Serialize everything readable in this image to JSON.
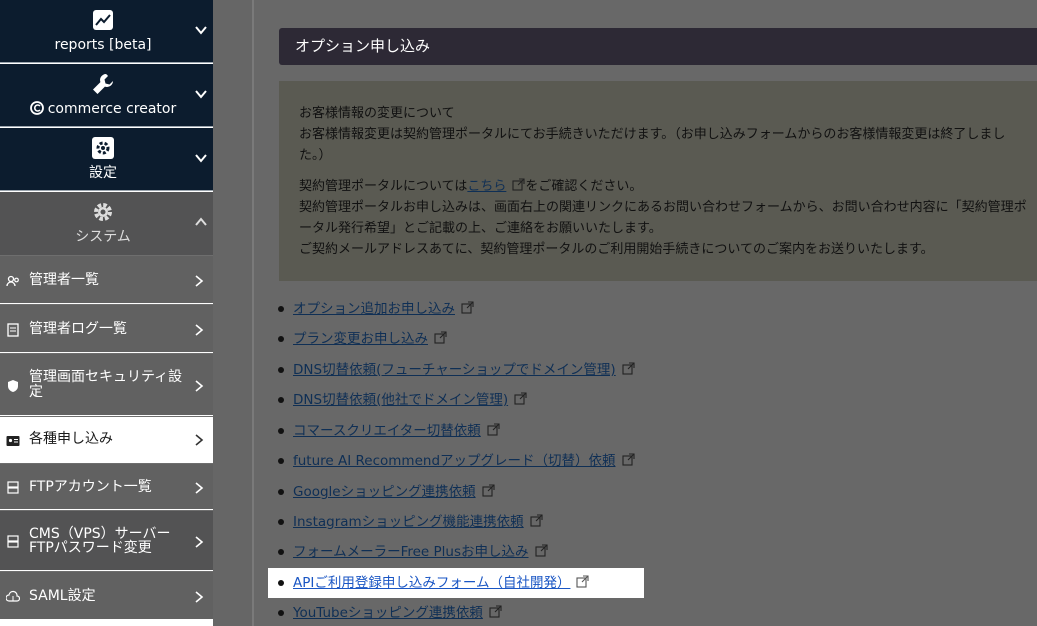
{
  "sidebar": {
    "major": [
      {
        "label": "reports [beta]",
        "icon": "chart-icon"
      },
      {
        "label": "commerce creator",
        "icon": "wrench-icon"
      },
      {
        "label": "設定",
        "icon": "gear-box-icon"
      },
      {
        "label": "システム",
        "icon": "gear-icon"
      }
    ],
    "items": [
      {
        "label": "管理者一覧",
        "icon": "users-icon"
      },
      {
        "label": "管理者ログ一覧",
        "icon": "log-icon"
      },
      {
        "label": "管理画面セキュリティ設定",
        "icon": "shield-icon"
      },
      {
        "label": "各種申し込み",
        "icon": "id-card-icon"
      },
      {
        "label": "FTPアカウント一覧",
        "icon": "server-icon"
      },
      {
        "label": "CMS（VPS）サーバーFTPパスワード変更",
        "icon": "server-icon"
      },
      {
        "label": "SAML設定",
        "icon": "cloud-icon"
      }
    ]
  },
  "main": {
    "section_title": "オプション申し込み",
    "notice": {
      "p1_line1": "お客様情報の変更について",
      "p1_line2": "お客様情報変更は契約管理ポータルにてお手続きいただけます。（お申し込みフォームからのお客様情報変更は終了しました。）",
      "p2_before": "契約管理ポータルについては",
      "p2_link": "こちら",
      "p2_after": "をご確認ください。",
      "p2_line2": "契約管理ポータルお申し込みは、画面右上の関連リンクにあるお問い合わせフォームから、お問い合わせ内容に「契約管理ポータル発行希望」とご記載の上、ご連絡をお願いいたします。",
      "p2_line3": "ご契約メールアドレスあてに、契約管理ポータルのご利用開始手続きについてのご案内をお送りいたします。"
    },
    "links": [
      "オプション追加お申し込み",
      "プラン変更お申し込み",
      "DNS切替依頼(フューチャーショップでドメイン管理)",
      "DNS切替依頼(他社でドメイン管理)",
      "コマースクリエイター切替依頼",
      "future AI Recommendアップグレード（切替）依頼",
      "Googleショッピング連携依頼",
      "Instagramショッピング機能連携依頼",
      "フォームメーラーFree Plusお申し込み",
      "APIご利用登録申し込みフォーム（自社開発）",
      "YouTubeショッピング連携依頼"
    ]
  },
  "colors": {
    "sidebar_dark": "#0c1c2e",
    "link": "#0f2f55",
    "header": "#2d2935"
  }
}
